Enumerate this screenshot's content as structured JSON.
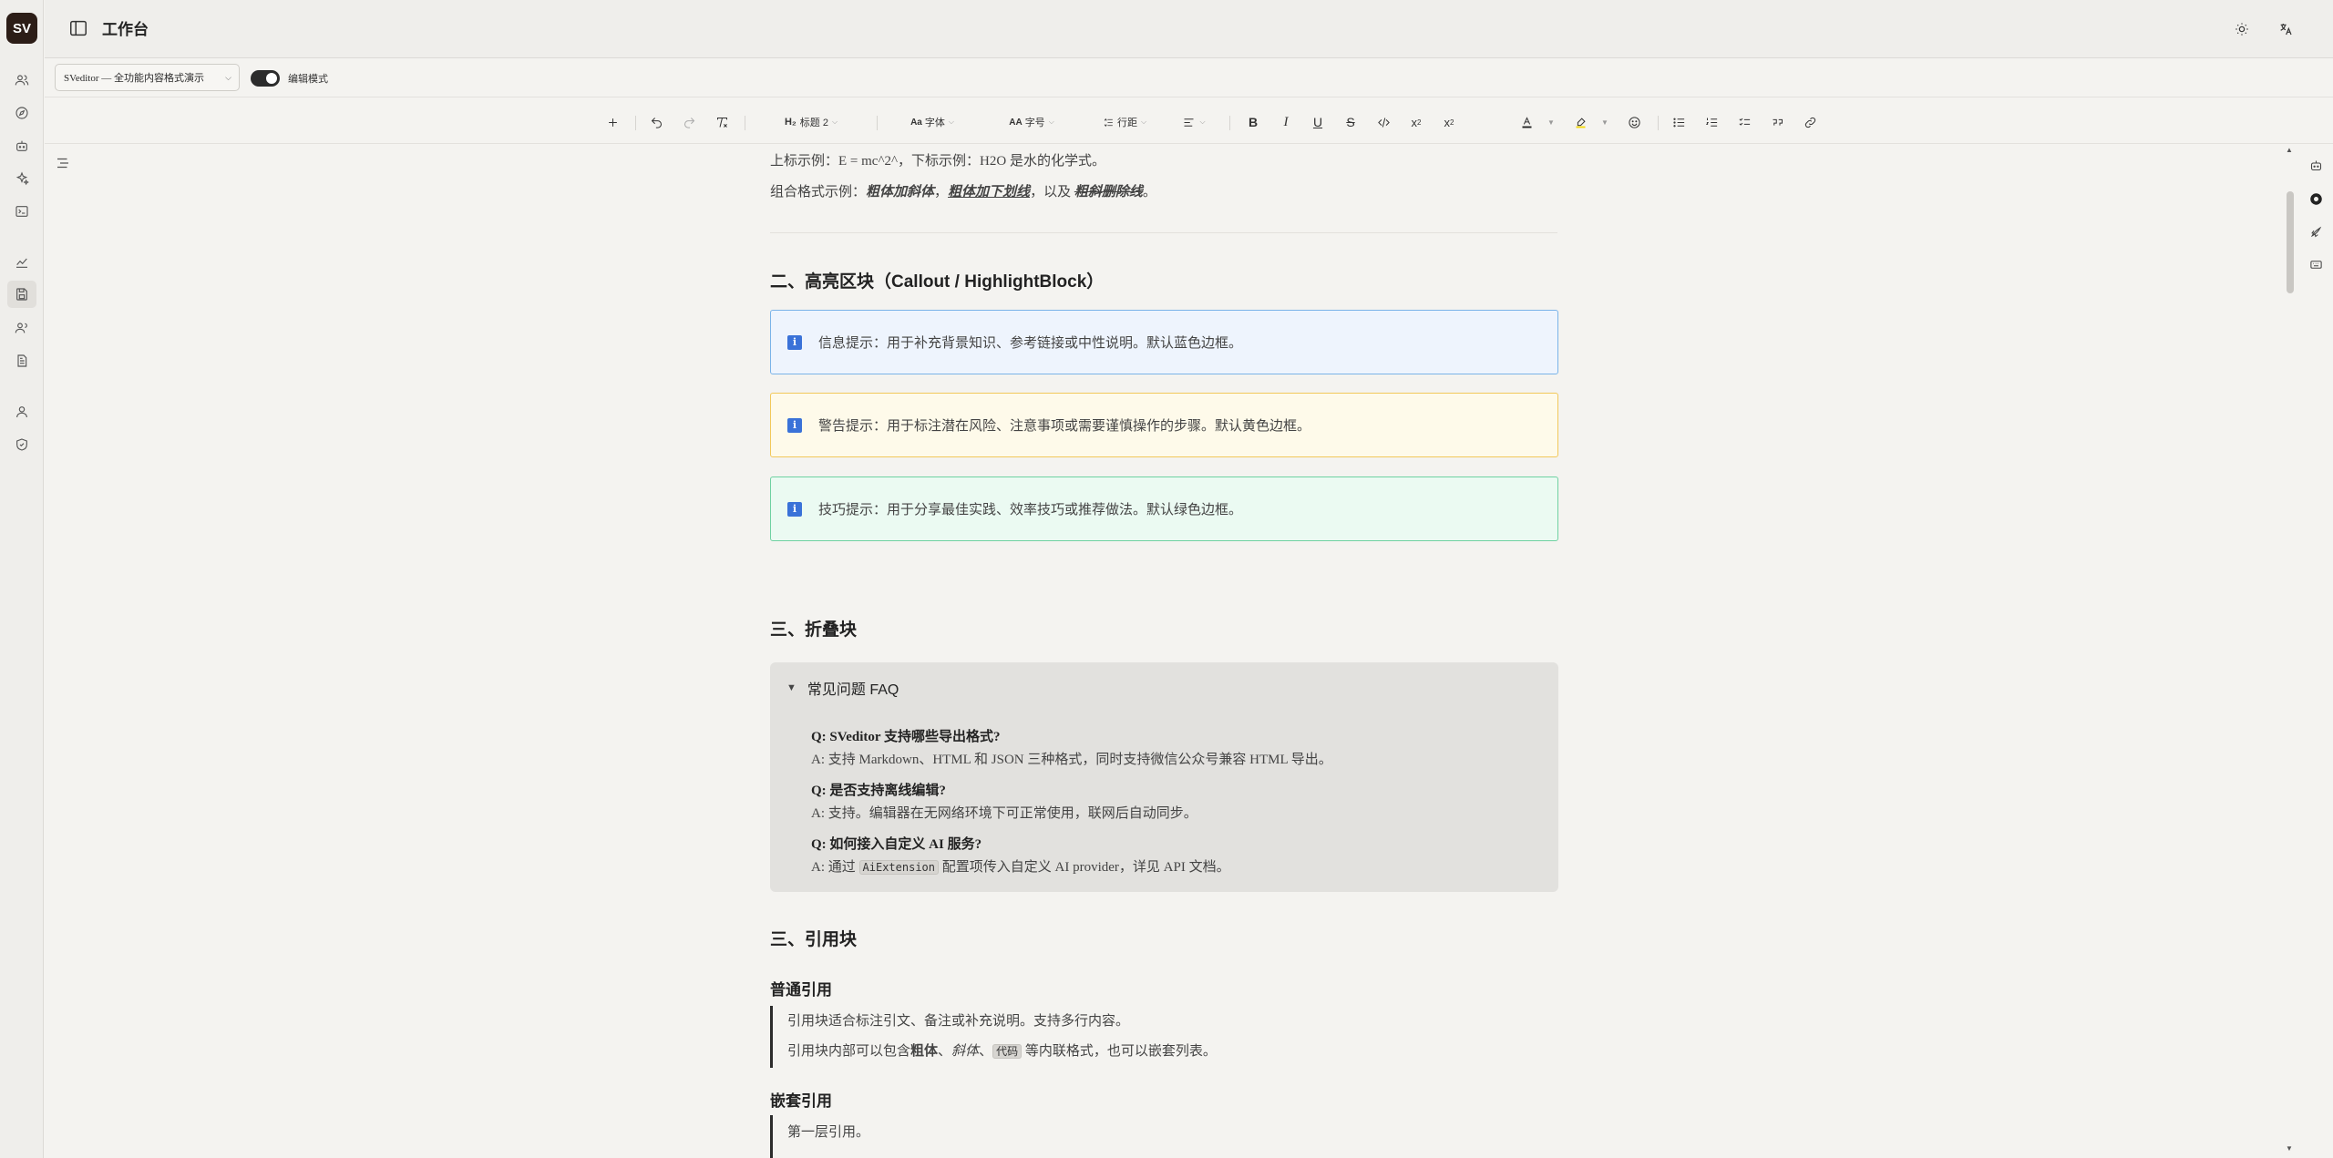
{
  "app": {
    "logo": "SV",
    "title": "工作台"
  },
  "rail": {
    "icons": [
      "users-icon",
      "compass-icon",
      "bot-icon",
      "sparkles-icon",
      "terminal-icon",
      "chart-icon",
      "save-icon",
      "team-icon",
      "document-icon",
      "user-icon",
      "shield-icon"
    ],
    "active": "save-icon"
  },
  "subbar": {
    "doc_select": "SVeditor — 全功能内容格式演示",
    "mode_label": "编辑模式",
    "mode_on": true
  },
  "toolbar": {
    "heading": "标题 2",
    "font": "字体",
    "font_size": "字号",
    "line_height": "行距"
  },
  "content": {
    "sup_line": "上标示例：E = mc^2^，下标示例：H2O 是水的化学式。",
    "combo_prefix": "组合格式示例：",
    "combo_bold_italic": "粗体加斜体",
    "combo_sep1": "，",
    "combo_bold_underline": "粗体加下划线",
    "combo_sep2": "，以及 ",
    "combo_bold_strike": "粗斜删除线",
    "combo_end": "。",
    "section2_title": "二、高亮区块（Callout / HighlightBlock）",
    "callouts": [
      {
        "icon": "i",
        "text": "信息提示：用于补充背景知识、参考链接或中性说明。默认蓝色边框。"
      },
      {
        "icon": "i",
        "text": "警告提示：用于标注潜在风险、注意事项或需要谨慎操作的步骤。默认黄色边框。"
      },
      {
        "icon": "i",
        "text": "技巧提示：用于分享最佳实践、效率技巧或推荐做法。默认绿色边框。"
      }
    ],
    "section3_title": "三、折叠块",
    "fold": {
      "title": "常见问题 FAQ",
      "q1": "Q: SVeditor 支持哪些导出格式?",
      "a1": "A: 支持 Markdown、HTML 和 JSON 三种格式，同时支持微信公众号兼容 HTML 导出。",
      "q2": "Q: 是否支持离线编辑?",
      "a2": "A: 支持。编辑器在无网络环境下可正常使用，联网后自动同步。",
      "q3": "Q: 如何接入自定义 AI 服务?",
      "a3_prefix": "A: 通过 ",
      "a3_code": "AiExtension",
      "a3_suffix": " 配置项传入自定义 AI provider，详见 API 文档。"
    },
    "section4_title": "三、引用块",
    "quote_normal_title": "普通引用",
    "quote_line1": "引用块适合标注引文、备注或补充说明。支持多行内容。",
    "quote_line2_prefix": "引用块内部可以包含",
    "quote_line2_bold": "粗体",
    "quote_line2_sep1": "、",
    "quote_line2_italic": "斜体",
    "quote_line2_sep2": "、",
    "quote_line2_code": "代码",
    "quote_line2_suffix": " 等内联格式，也可以嵌套列表。",
    "quote_nested_title": "嵌套引用",
    "nested_line1": "第一层引用。"
  },
  "colors": {
    "accent": "#2c1d17",
    "info_border": "#7ab3e8",
    "warn_border": "#f2c85a",
    "tip_border": "#6fd1a2"
  }
}
